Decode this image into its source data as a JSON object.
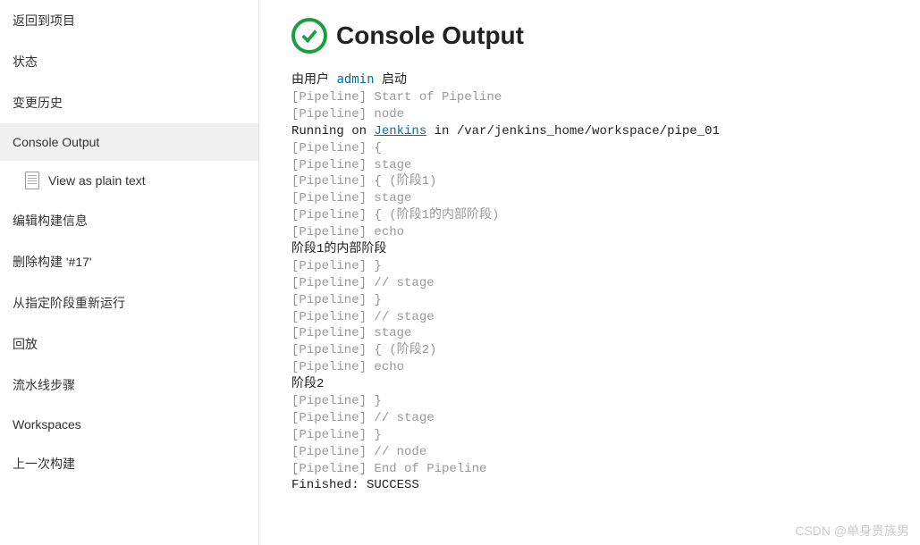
{
  "sidebar": {
    "items": [
      {
        "label": "返回到项目"
      },
      {
        "label": "状态"
      },
      {
        "label": "变更历史"
      },
      {
        "label": "Console Output"
      },
      {
        "label": "View as plain text"
      },
      {
        "label": "编辑构建信息"
      },
      {
        "label": "删除构建 '#17'"
      },
      {
        "label": "从指定阶段重新运行"
      },
      {
        "label": "回放"
      },
      {
        "label": "流水线步骤"
      },
      {
        "label": "Workspaces"
      },
      {
        "label": "上一次构建"
      }
    ]
  },
  "title": "Console Output",
  "started_by": {
    "prefix": "由用户 ",
    "user": "admin",
    "suffix": " 启动"
  },
  "running_on": {
    "prefix": "Running on ",
    "node": "Jenkins",
    "suffix": " in /var/jenkins_home/workspace/pipe_01"
  },
  "lines": [
    {
      "text": "[Pipeline] Start of Pipeline",
      "cls": "gray"
    },
    {
      "text": "[Pipeline] node",
      "cls": "gray"
    },
    {
      "text": "__RUNNING_ON__",
      "cls": "black"
    },
    {
      "text": "[Pipeline] {",
      "cls": "gray"
    },
    {
      "text": "[Pipeline] stage",
      "cls": "gray"
    },
    {
      "text": "[Pipeline] { (阶段1)",
      "cls": "gray"
    },
    {
      "text": "[Pipeline] stage",
      "cls": "gray"
    },
    {
      "text": "[Pipeline] { (阶段1的内部阶段)",
      "cls": "gray"
    },
    {
      "text": "[Pipeline] echo",
      "cls": "gray"
    },
    {
      "text": "阶段1的内部阶段",
      "cls": "black"
    },
    {
      "text": "[Pipeline] }",
      "cls": "gray"
    },
    {
      "text": "[Pipeline] // stage",
      "cls": "gray"
    },
    {
      "text": "[Pipeline] }",
      "cls": "gray"
    },
    {
      "text": "[Pipeline] // stage",
      "cls": "gray"
    },
    {
      "text": "[Pipeline] stage",
      "cls": "gray"
    },
    {
      "text": "[Pipeline] { (阶段2)",
      "cls": "gray"
    },
    {
      "text": "[Pipeline] echo",
      "cls": "gray"
    },
    {
      "text": "阶段2",
      "cls": "black"
    },
    {
      "text": "[Pipeline] }",
      "cls": "gray"
    },
    {
      "text": "[Pipeline] // stage",
      "cls": "gray"
    },
    {
      "text": "[Pipeline] }",
      "cls": "gray"
    },
    {
      "text": "[Pipeline] // node",
      "cls": "gray"
    },
    {
      "text": "[Pipeline] End of Pipeline",
      "cls": "gray"
    },
    {
      "text": "Finished: SUCCESS",
      "cls": "black"
    }
  ],
  "watermark": "CSDN @单身贵族男"
}
